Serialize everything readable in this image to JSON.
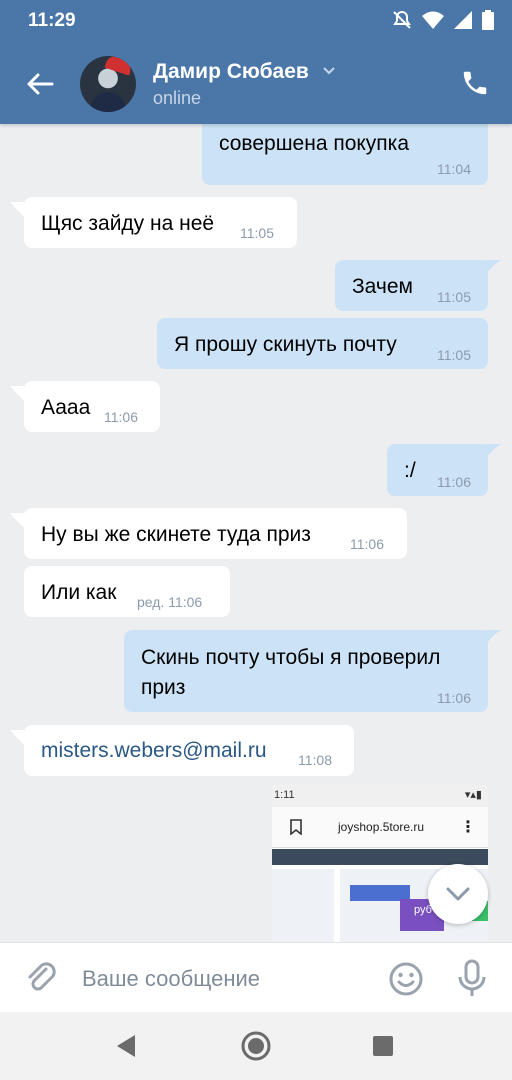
{
  "status_bar": {
    "time": "11:29"
  },
  "header": {
    "contact_name": "Дамир Сюбаев",
    "contact_status": "online"
  },
  "messages": [
    {
      "dir": "out",
      "text": "совершена покупка",
      "time": "11:04"
    },
    {
      "dir": "in",
      "text": "Щяс зайду на неё",
      "time": "11:05"
    },
    {
      "dir": "out",
      "text": "Зачем",
      "time": "11:05"
    },
    {
      "dir": "out",
      "text": "Я прошу скинуть почту",
      "time": "11:05"
    },
    {
      "dir": "in",
      "text": "Аааа",
      "time": "11:06"
    },
    {
      "dir": "out",
      "text": ":/",
      "time": "11:06"
    },
    {
      "dir": "in",
      "text": "Ну вы же скинете туда приз",
      "time": "11:06"
    },
    {
      "dir": "in",
      "text": "Или как",
      "time": "ред. 11:06"
    },
    {
      "dir": "out",
      "text_line1": "Скинь почту чтобы я проверил",
      "text_line2": "приз",
      "time": "11:06"
    },
    {
      "dir": "in",
      "text": "misters.webers@mail.ru",
      "time": "11:08",
      "is_link": true
    }
  ],
  "attachment": {
    "status_time": "1:11",
    "url_text": "joyshop.5tore.ru",
    "badge_text": "руб"
  },
  "composer": {
    "placeholder": "Ваше сообщение"
  },
  "colors": {
    "header": "#4a76a8",
    "incoming": "#ffffff",
    "outgoing": "#cce3f7",
    "background": "#edeef0",
    "link": "#2a5885"
  }
}
